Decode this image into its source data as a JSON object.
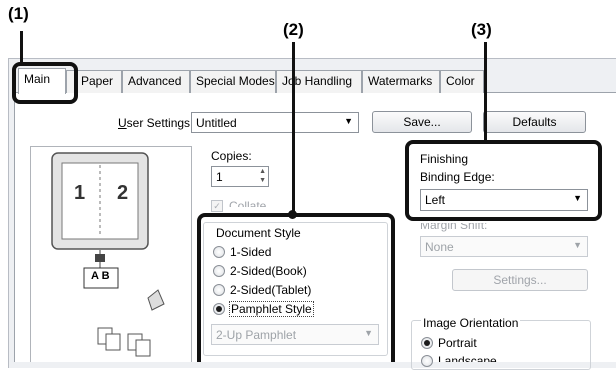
{
  "callouts": {
    "c1": "(1)",
    "c2": "(2)",
    "c3": "(3)"
  },
  "tabs": [
    "Main",
    "Paper",
    "Advanced",
    "Special Modes",
    "Job Handling",
    "Watermarks",
    "Color"
  ],
  "user_settings": {
    "label_u": "U",
    "label_rest": "ser Settings:",
    "value": "Untitled",
    "save": "Save...",
    "defaults": "Defaults"
  },
  "preview": {
    "page_left": "1",
    "page_right": "2",
    "book_label": "A B"
  },
  "copies": {
    "label": "Copies:",
    "value": "1",
    "collate": "Collate"
  },
  "document_style": {
    "title": "Document Style",
    "options": [
      "1-Sided",
      "2-Sided(Book)",
      "2-Sided(Tablet)",
      "Pamphlet Style"
    ],
    "selected_index": 3,
    "pamphlet_combo": "2-Up Pamphlet"
  },
  "finishing": {
    "title": "Finishing",
    "binding_label": "Binding Edge:",
    "binding_value": "Left"
  },
  "margin_shift": {
    "label": "Margin Shift:",
    "value": "None",
    "settings": "Settings..."
  },
  "orientation": {
    "title": "Image Orientation",
    "options": [
      "Portrait",
      "Landscape"
    ],
    "selected_index": 0
  }
}
